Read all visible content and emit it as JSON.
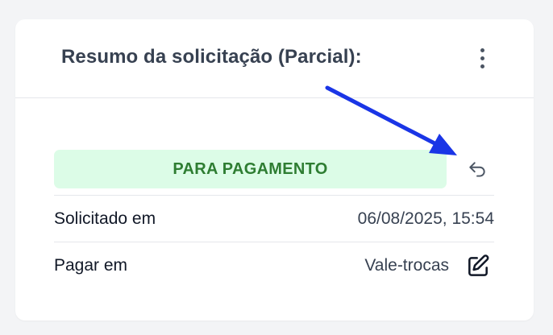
{
  "card": {
    "title": "Resumo da solicitação (Parcial):",
    "menu_icon": "kebab-vertical-icon"
  },
  "status": {
    "label": "PARA PAGAMENTO",
    "color": "#2e7d32",
    "background": "#dcfce7",
    "undo_icon": "undo-arrow-icon"
  },
  "details": {
    "requested_label": "Solicitado em",
    "requested_value": "06/08/2025, 15:54",
    "pay_label": "Pagar em",
    "pay_value": "Vale-trocas",
    "edit_icon": "edit-pencil-icon"
  },
  "annotation": {
    "arrow_color": "#1a35e6"
  }
}
